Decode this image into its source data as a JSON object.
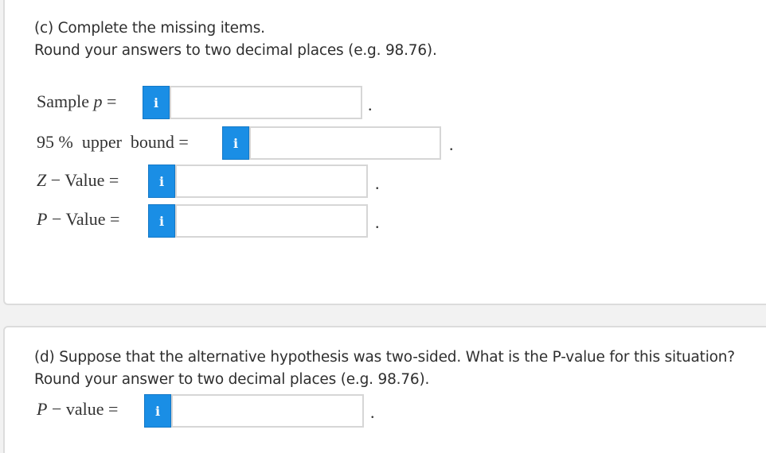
{
  "part_c": {
    "prompt_line1": "(c) Complete the missing items.",
    "prompt_line2": "Round your answers to two decimal places (e.g. 98.76).",
    "rows": [
      {
        "label_text": "Sample",
        "label_var": "p",
        "label_suffix": " =",
        "info_icon": "i",
        "value": "",
        "terminator": "."
      },
      {
        "label_text": "95 %  upper  bound =",
        "label_var": "",
        "label_suffix": "",
        "info_icon": "i",
        "value": "",
        "terminator": "."
      },
      {
        "label_text": "",
        "label_var": "Z",
        "label_suffix": " − Value =",
        "info_icon": "i",
        "value": "",
        "terminator": "."
      },
      {
        "label_text": "",
        "label_var": "P",
        "label_suffix": " − Value =",
        "info_icon": "i",
        "value": "",
        "terminator": "."
      }
    ]
  },
  "part_d": {
    "prompt_line1": "(d) Suppose that the alternative hypothesis was two-sided. What is the P-value for this situation?",
    "prompt_line2": "Round your answer to two decimal places (e.g. 98.76).",
    "row": {
      "label_var": "P",
      "label_suffix": " − value =",
      "info_icon": "i",
      "value": "",
      "terminator": "."
    }
  },
  "colors": {
    "info_button": "#1a8ee5",
    "panel_border": "#dcdcdc",
    "input_border": "#d6d6d6"
  },
  "icons": {
    "info": "info-icon"
  }
}
